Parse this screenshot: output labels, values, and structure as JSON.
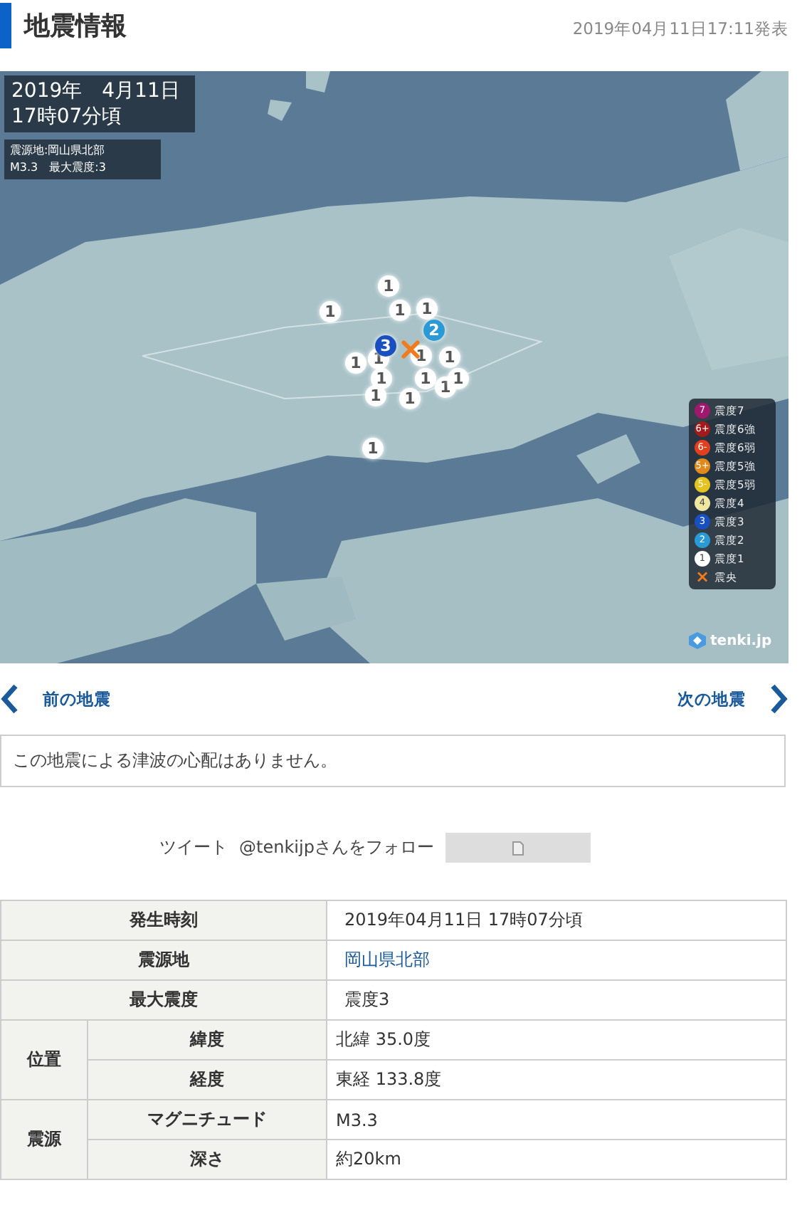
{
  "header": {
    "title": "地震情報",
    "published": "2019年04月11日17:11発表"
  },
  "map": {
    "date_lines": [
      "2019年　4月11日",
      "17時07分頃"
    ],
    "info_lines": [
      "震源地:岡山県北部",
      "M3.3　最大震度:3"
    ],
    "markers": [
      {
        "label": "1",
        "color": "#ffffff"
      },
      {
        "label": "1",
        "color": "#ffffff"
      },
      {
        "label": "1",
        "color": "#ffffff"
      },
      {
        "label": "1",
        "color": "#ffffff"
      },
      {
        "label": "1",
        "color": "#ffffff"
      },
      {
        "label": "1",
        "color": "#ffffff"
      },
      {
        "label": "1",
        "color": "#ffffff"
      },
      {
        "label": "1",
        "color": "#ffffff"
      },
      {
        "label": "1",
        "color": "#ffffff"
      },
      {
        "label": "1",
        "color": "#ffffff"
      },
      {
        "label": "1",
        "color": "#ffffff"
      },
      {
        "label": "1",
        "color": "#ffffff"
      },
      {
        "label": "1",
        "color": "#ffffff"
      },
      {
        "label": "1",
        "color": "#ffffff"
      },
      {
        "label": "1",
        "color": "#ffffff"
      },
      {
        "label": "2",
        "color": "#2a9ad6"
      },
      {
        "label": "3",
        "color": "#1a4fc0"
      }
    ],
    "legend": [
      {
        "symbol": "7",
        "label": "震度7",
        "color": "#a0186e"
      },
      {
        "symbol": "6+",
        "label": "震度6強",
        "color": "#a01c1c"
      },
      {
        "symbol": "6-",
        "label": "震度6弱",
        "color": "#e0401e"
      },
      {
        "symbol": "5+",
        "label": "震度5強",
        "color": "#e08a1e"
      },
      {
        "symbol": "5-",
        "label": "震度5弱",
        "color": "#e6c21e"
      },
      {
        "symbol": "4",
        "label": "震度4",
        "color": "#f0e6a0"
      },
      {
        "symbol": "3",
        "label": "震度3",
        "color": "#1a4fc0"
      },
      {
        "symbol": "2",
        "label": "震度2",
        "color": "#2a9ad6"
      },
      {
        "symbol": "1",
        "label": "震度1",
        "color": "#ffffff"
      },
      {
        "symbol": "×",
        "label": "震央",
        "color": "#f07a1e"
      }
    ],
    "logo": "tenki.jp"
  },
  "nav": {
    "prev": "前の地震",
    "next": "次の地震"
  },
  "tsunami": "この地震による津波の心配はありません。",
  "social": {
    "tweet": "ツイート",
    "follow": "@tenkijpさんをフォロー"
  },
  "table": {
    "rows": [
      {
        "label": "発生時刻",
        "value": "2019年04月11日 17時07分頃"
      },
      {
        "label": "震源地",
        "value": "岡山県北部",
        "kind": "link"
      },
      {
        "label": "最大震度",
        "value": "震度3"
      },
      {
        "group": "位置",
        "items": [
          {
            "label": "緯度",
            "value": "北緯 35.0度"
          },
          {
            "label": "経度",
            "value": "東経 133.8度"
          }
        ]
      },
      {
        "group": "震源",
        "items": [
          {
            "label": "マグニチュード",
            "value": "M3.3"
          },
          {
            "label": "深さ",
            "value": "約20km"
          }
        ]
      }
    ]
  }
}
